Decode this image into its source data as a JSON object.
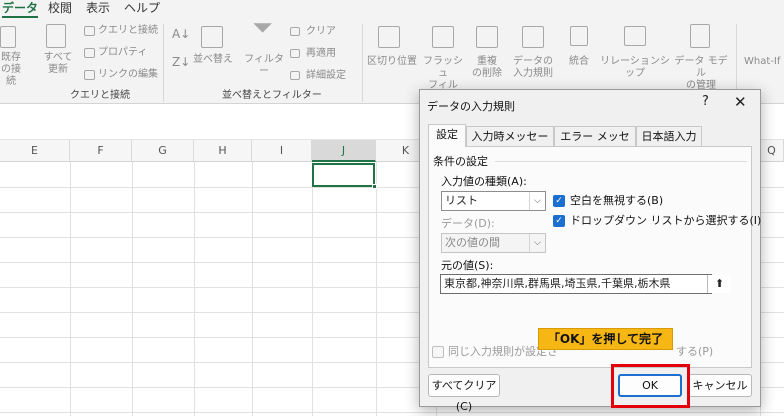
{
  "ribbon": {
    "tabs": [
      "データ",
      "校閲",
      "表示",
      "ヘルプ"
    ],
    "active_tab": "データ",
    "accent": "#217346",
    "items": {
      "existing": [
        "既存",
        "の接続"
      ],
      "refresh_all": [
        "すべて",
        "更新"
      ],
      "queries": "クエリと接続",
      "properties": "プロパティ",
      "edit_links": "リンクの編集",
      "sort": "並べ替え",
      "filter": "フィルター",
      "clear": "クリア",
      "reapply": "再適用",
      "advanced": "詳細設定",
      "text_to_columns": "区切り位置",
      "flash_fill": [
        "フラッシュ",
        "フィル"
      ],
      "remove_dup": [
        "重複",
        "の削除"
      ],
      "data_validation": [
        "データの",
        "入力規則"
      ],
      "consolidate": "統合",
      "relationships": "リレーションシップ",
      "data_model": [
        "データ モデル",
        "の管理"
      ],
      "what_if": "What-If"
    },
    "groups": {
      "queries": "クエリと接続",
      "sort_filter": "並べ替えとフィルター"
    }
  },
  "sheet": {
    "columns": [
      "E",
      "F",
      "G",
      "H",
      "I",
      "J",
      "K",
      "Q"
    ],
    "selected_column": "J"
  },
  "dialog": {
    "title": "データの入力規則",
    "help": "?",
    "close": "✕",
    "tabs": [
      "設定",
      "入力時メッセージ",
      "エラー メッセージ",
      "日本語入力"
    ],
    "active_tab": "設定",
    "section": "条件の設定",
    "allow_label": "入力値の種類(A):",
    "allow_value": "リスト",
    "ignore_blank": {
      "label": "空白を無視する(B)",
      "checked": true
    },
    "in_cell_dropdown": {
      "label": "ドロップダウン リストから選択する(I)",
      "checked": true
    },
    "data_label": "データ(D):",
    "data_value": "次の値の間",
    "source_label": "元の値(S):",
    "source_value": "東京都,神奈川県,群馬県,埼玉県,千葉県,栃木県",
    "collapse_icon": "⬆",
    "apply_all": {
      "label_start": "同じ入力規則が設定さ",
      "label_end": "する(P)",
      "checked": false
    },
    "clear_all": "すべてクリア(C)",
    "ok": "OK",
    "cancel": "キャンセル"
  },
  "annotation": {
    "callout": "「OK」を押して完了",
    "callout_color": "#f6b715",
    "highlight_color": "#e3000b"
  }
}
